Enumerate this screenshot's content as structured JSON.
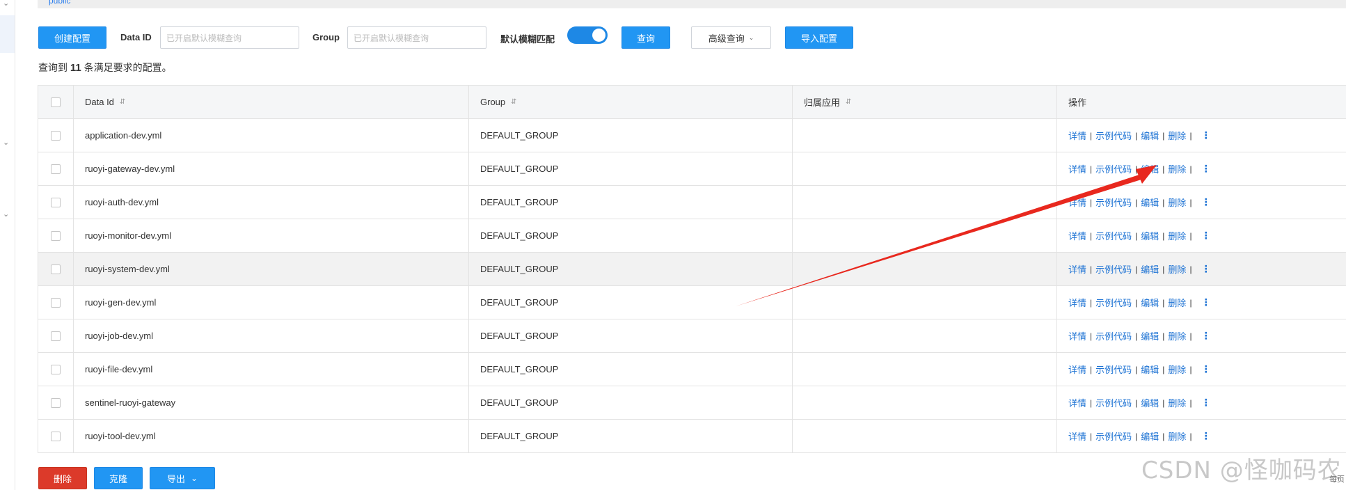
{
  "top": {
    "namespace": "public"
  },
  "toolbar": {
    "create_label": "创建配置",
    "dataid_label": "Data ID",
    "dataid_placeholder": "已开启默认模糊查询",
    "group_label": "Group",
    "group_placeholder": "已开启默认模糊查询",
    "fuzzy_label": "默认模糊匹配",
    "fuzzy_on": true,
    "query_label": "查询",
    "advanced_label": "高级查询",
    "import_label": "导入配置"
  },
  "summary": {
    "prefix": "查询到",
    "count": "11",
    "suffix": "条满足要求的配置。"
  },
  "table": {
    "headers": {
      "data_id": "Data Id",
      "group": "Group",
      "app": "归属应用",
      "ops": "操作"
    },
    "sort_icon": "⇵",
    "ops": {
      "detail": "详情",
      "sample": "示例代码",
      "edit": "编辑",
      "delete": "删除",
      "sep": "|"
    },
    "rows": [
      {
        "data_id": "application-dev.yml",
        "group": "DEFAULT_GROUP",
        "app": ""
      },
      {
        "data_id": "ruoyi-gateway-dev.yml",
        "group": "DEFAULT_GROUP",
        "app": ""
      },
      {
        "data_id": "ruoyi-auth-dev.yml",
        "group": "DEFAULT_GROUP",
        "app": ""
      },
      {
        "data_id": "ruoyi-monitor-dev.yml",
        "group": "DEFAULT_GROUP",
        "app": ""
      },
      {
        "data_id": "ruoyi-system-dev.yml",
        "group": "DEFAULT_GROUP",
        "app": ""
      },
      {
        "data_id": "ruoyi-gen-dev.yml",
        "group": "DEFAULT_GROUP",
        "app": ""
      },
      {
        "data_id": "ruoyi-job-dev.yml",
        "group": "DEFAULT_GROUP",
        "app": ""
      },
      {
        "data_id": "ruoyi-file-dev.yml",
        "group": "DEFAULT_GROUP",
        "app": ""
      },
      {
        "data_id": "sentinel-ruoyi-gateway",
        "group": "DEFAULT_GROUP",
        "app": ""
      },
      {
        "data_id": "ruoyi-tool-dev.yml",
        "group": "DEFAULT_GROUP",
        "app": ""
      }
    ]
  },
  "bottom": {
    "delete_label": "删除",
    "clone_label": "克隆",
    "export_label": "导出"
  },
  "watermark": "CSDN @怪咖码农",
  "page_hint": "每页",
  "colors": {
    "primary": "#2196f3",
    "danger": "#dc3a2a",
    "link": "#1e73d4",
    "arrow": "#e8281e"
  }
}
